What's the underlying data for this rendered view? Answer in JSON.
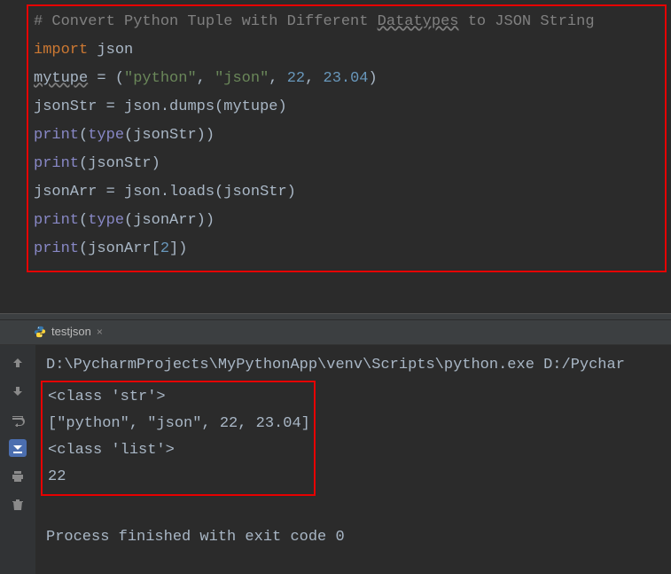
{
  "code": {
    "comment_prefix": "# ",
    "comment_text_before": "Convert Python Tuple with Different ",
    "comment_underlined": "Datatypes",
    "comment_text_after": " to JSON String",
    "kw_import": "import",
    "mod_json": " json",
    "var_mytupe": "mytupe",
    "assign_space": " = ",
    "paren_open": "(",
    "str_python": "\"python\"",
    "comma": ", ",
    "str_json": "\"json\"",
    "num_22": "22",
    "num_2304": "23.04",
    "paren_close": ")",
    "var_jsonStr": "jsonStr",
    "json_dumps_call": "json.dumps",
    "call_mytupe": "(mytupe)",
    "fn_print": "print",
    "fn_type": "type",
    "call_jsonStr": "(jsonStr)",
    "call_jsonStr_only": "(jsonStr)",
    "var_jsonArr": "jsonArr",
    "json_loads_call": "json.loads",
    "call_jsonArr": "(jsonArr)",
    "idx_open": "(jsonArr[",
    "idx_2": "2",
    "idx_close": "])",
    "wrap_open": "(",
    "wrap_close": ")",
    "double_close": "))"
  },
  "tab": {
    "name": "testjson",
    "close": "×"
  },
  "console": {
    "cmd": "D:\\PycharmProjects\\MyPythonApp\\venv\\Scripts\\python.exe D:/Pychar",
    "out1": "<class 'str'>",
    "out2": "[\"python\", \"json\", 22, 23.04]",
    "out3": "<class 'list'>",
    "out4": "22",
    "finished": "Process finished with exit code 0"
  }
}
